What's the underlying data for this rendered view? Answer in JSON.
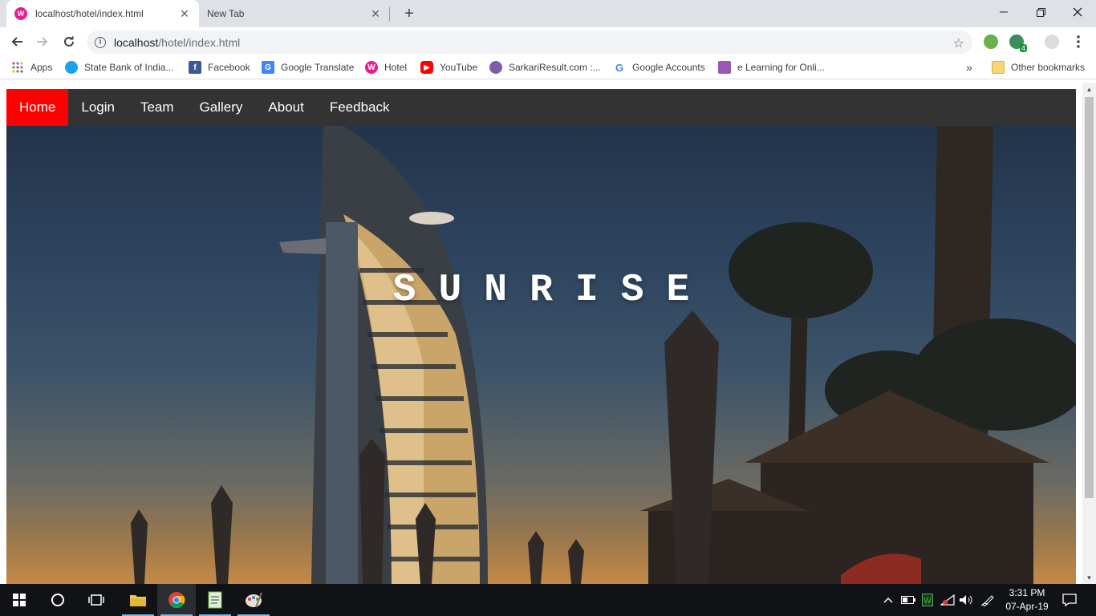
{
  "browser": {
    "tabs": [
      {
        "title": "localhost/hotel/index.html",
        "favicon": "wamp-icon",
        "active": true
      },
      {
        "title": "New Tab",
        "active": false
      }
    ],
    "new_tab_label": "+",
    "url": {
      "host": "localhost",
      "path": "/hotel/index.html"
    },
    "bookmarks": [
      {
        "label": "Apps",
        "icon": "apps-grid-icon"
      },
      {
        "label": "State Bank of India...",
        "icon": "sbi-icon"
      },
      {
        "label": "Facebook",
        "icon": "facebook-icon"
      },
      {
        "label": "Google Translate",
        "icon": "translate-icon"
      },
      {
        "label": "Hotel",
        "icon": "wamp-icon"
      },
      {
        "label": "YouTube",
        "icon": "youtube-icon"
      },
      {
        "label": "SarkariResult.com :...",
        "icon": "globe-icon"
      },
      {
        "label": "Google Accounts",
        "icon": "google-icon"
      },
      {
        "label": "e Learning for Onli...",
        "icon": "elearning-icon"
      }
    ],
    "overflow_label": "»",
    "other_bookmarks": "Other bookmarks",
    "extension_badge": "4"
  },
  "page": {
    "nav": [
      {
        "label": "Home",
        "active": true
      },
      {
        "label": "Login",
        "active": false
      },
      {
        "label": "Team",
        "active": false
      },
      {
        "label": "Gallery",
        "active": false
      },
      {
        "label": "About",
        "active": false
      },
      {
        "label": "Feedback",
        "active": false
      }
    ],
    "hero_title": "SUNRISE",
    "colors": {
      "nav_bg": "#333333",
      "nav_active": "#ff0000",
      "hero_text": "#ffffff"
    }
  },
  "taskbar": {
    "clock_time": "3:31 PM",
    "clock_date": "07-Apr-19",
    "apps": [
      "windows-start-icon",
      "cortana-icon",
      "task-view-icon",
      "file-explorer-icon",
      "chrome-icon",
      "notepad-icon",
      "paint-icon"
    ]
  }
}
